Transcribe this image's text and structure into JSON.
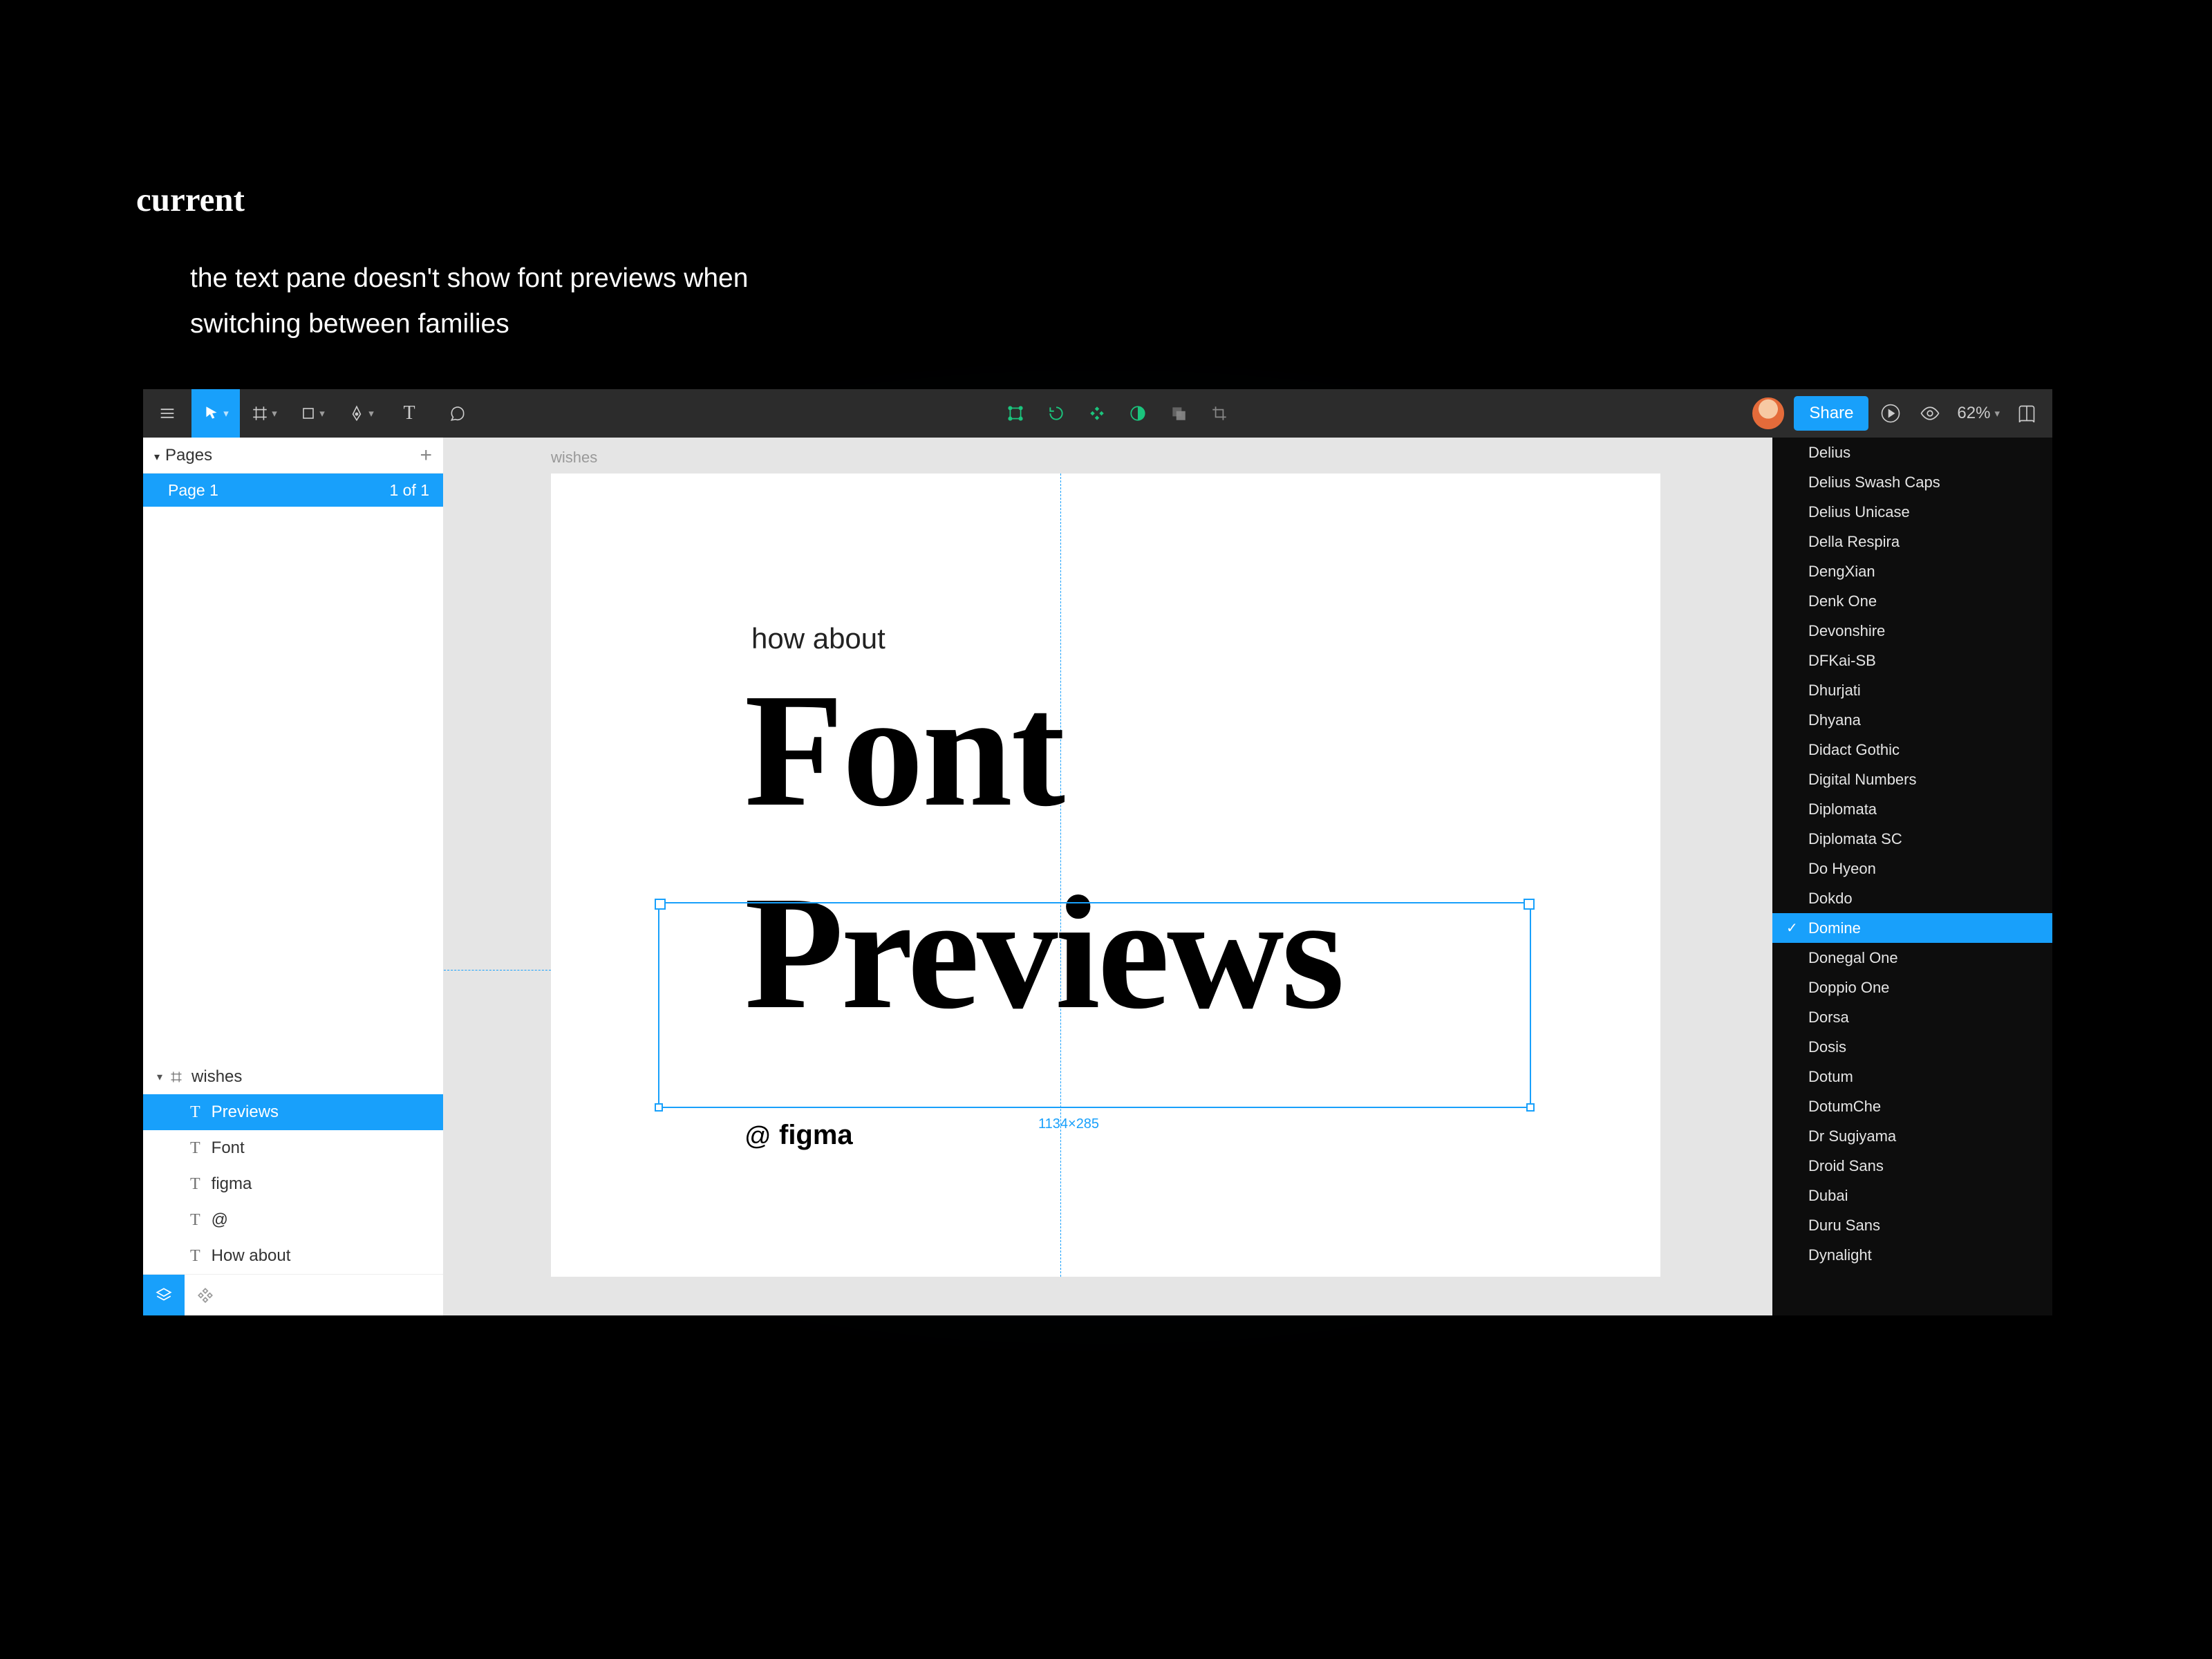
{
  "slide": {
    "heading": "current",
    "caption": "the text pane doesn't show font previews when switching between families"
  },
  "toolbar": {
    "share_label": "Share",
    "zoom_label": "62%"
  },
  "left_panel": {
    "pages_label": "Pages",
    "page_name": "Page 1",
    "page_count": "1 of 1",
    "frame_name": "wishes",
    "layers": [
      {
        "name": "Previews",
        "selected": true
      },
      {
        "name": "Font",
        "selected": false
      },
      {
        "name": "figma",
        "selected": false
      },
      {
        "name": "@",
        "selected": false
      },
      {
        "name": "How about",
        "selected": false
      }
    ]
  },
  "canvas": {
    "frame_label": "wishes",
    "text_howabout": "how about",
    "text_font": "Font",
    "text_previews": "Previews",
    "text_at": "@",
    "text_figma": "figma",
    "selection_dims": "1134×285"
  },
  "font_dropdown": {
    "selected": "Domine",
    "items": [
      "Delius",
      "Delius Swash Caps",
      "Delius Unicase",
      "Della Respira",
      "DengXian",
      "Denk One",
      "Devonshire",
      "DFKai-SB",
      "Dhurjati",
      "Dhyana",
      "Didact Gothic",
      "Digital Numbers",
      "Diplomata",
      "Diplomata SC",
      "Do Hyeon",
      "Dokdo",
      "Domine",
      "Donegal One",
      "Doppio One",
      "Dorsa",
      "Dosis",
      "Dotum",
      "DotumChe",
      "Dr Sugiyama",
      "Droid Sans",
      "Dubai",
      "Duru Sans",
      "Dynalight"
    ]
  }
}
